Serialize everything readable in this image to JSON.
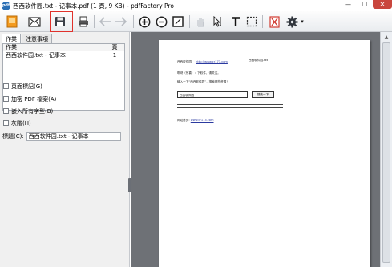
{
  "window": {
    "title": "西西软件园.txt - 记事本.pdf (1 頁, 9 KB) - pdfFactory Pro",
    "logo_text": "pdf",
    "minimize": "—",
    "maximize": "☐",
    "close": "✕"
  },
  "toolbar": {
    "icons": [
      "document-icon",
      "envelope-icon",
      "save-icon",
      "print-icon",
      "back-arrow-icon",
      "forward-arrow-icon",
      "zoom-in-icon",
      "zoom-out-icon",
      "fit-page-icon",
      "hand-icon",
      "select-cursor-icon",
      "text-tool-icon",
      "marquee-select-icon",
      "delete-page-icon",
      "settings-gear-icon"
    ],
    "settings_dropdown_arrow": "▾"
  },
  "tabs": [
    {
      "label": "作業",
      "active": true
    },
    {
      "label": "注意事項",
      "active": false
    }
  ],
  "job_list": {
    "columns": [
      "作業",
      "頁"
    ],
    "rows": [
      {
        "name": "西西软件园.txt - 记事本",
        "pages": "1"
      }
    ]
  },
  "options": [
    {
      "label": "頁面標記(G)",
      "checked": false
    },
    {
      "label": "加密 PDF 檔案(A)",
      "checked": false
    },
    {
      "label": "嵌入所有字型(B)",
      "checked": false
    },
    {
      "label": "灰階(H)",
      "checked": false
    }
  ],
  "title_field": {
    "label": "標題(C):",
    "value": "西西软件园.txt - 记事本"
  },
  "document": {
    "line1_left": "西西软件园",
    "line1_link": "http://www.cr173.com",
    "line1_right": "西西软件园.txt",
    "line2": "啊呀（惊喜）：下软件，请关注。",
    "line3": "输入一下“西西软件园”，搜索哪些资源！",
    "input_value": "西西软件园",
    "button_label": "搜索一下",
    "footer_label": "网站首页:",
    "footer_link": "www.cr173.com"
  },
  "scrollbar": {
    "up_arrow": "▲"
  }
}
